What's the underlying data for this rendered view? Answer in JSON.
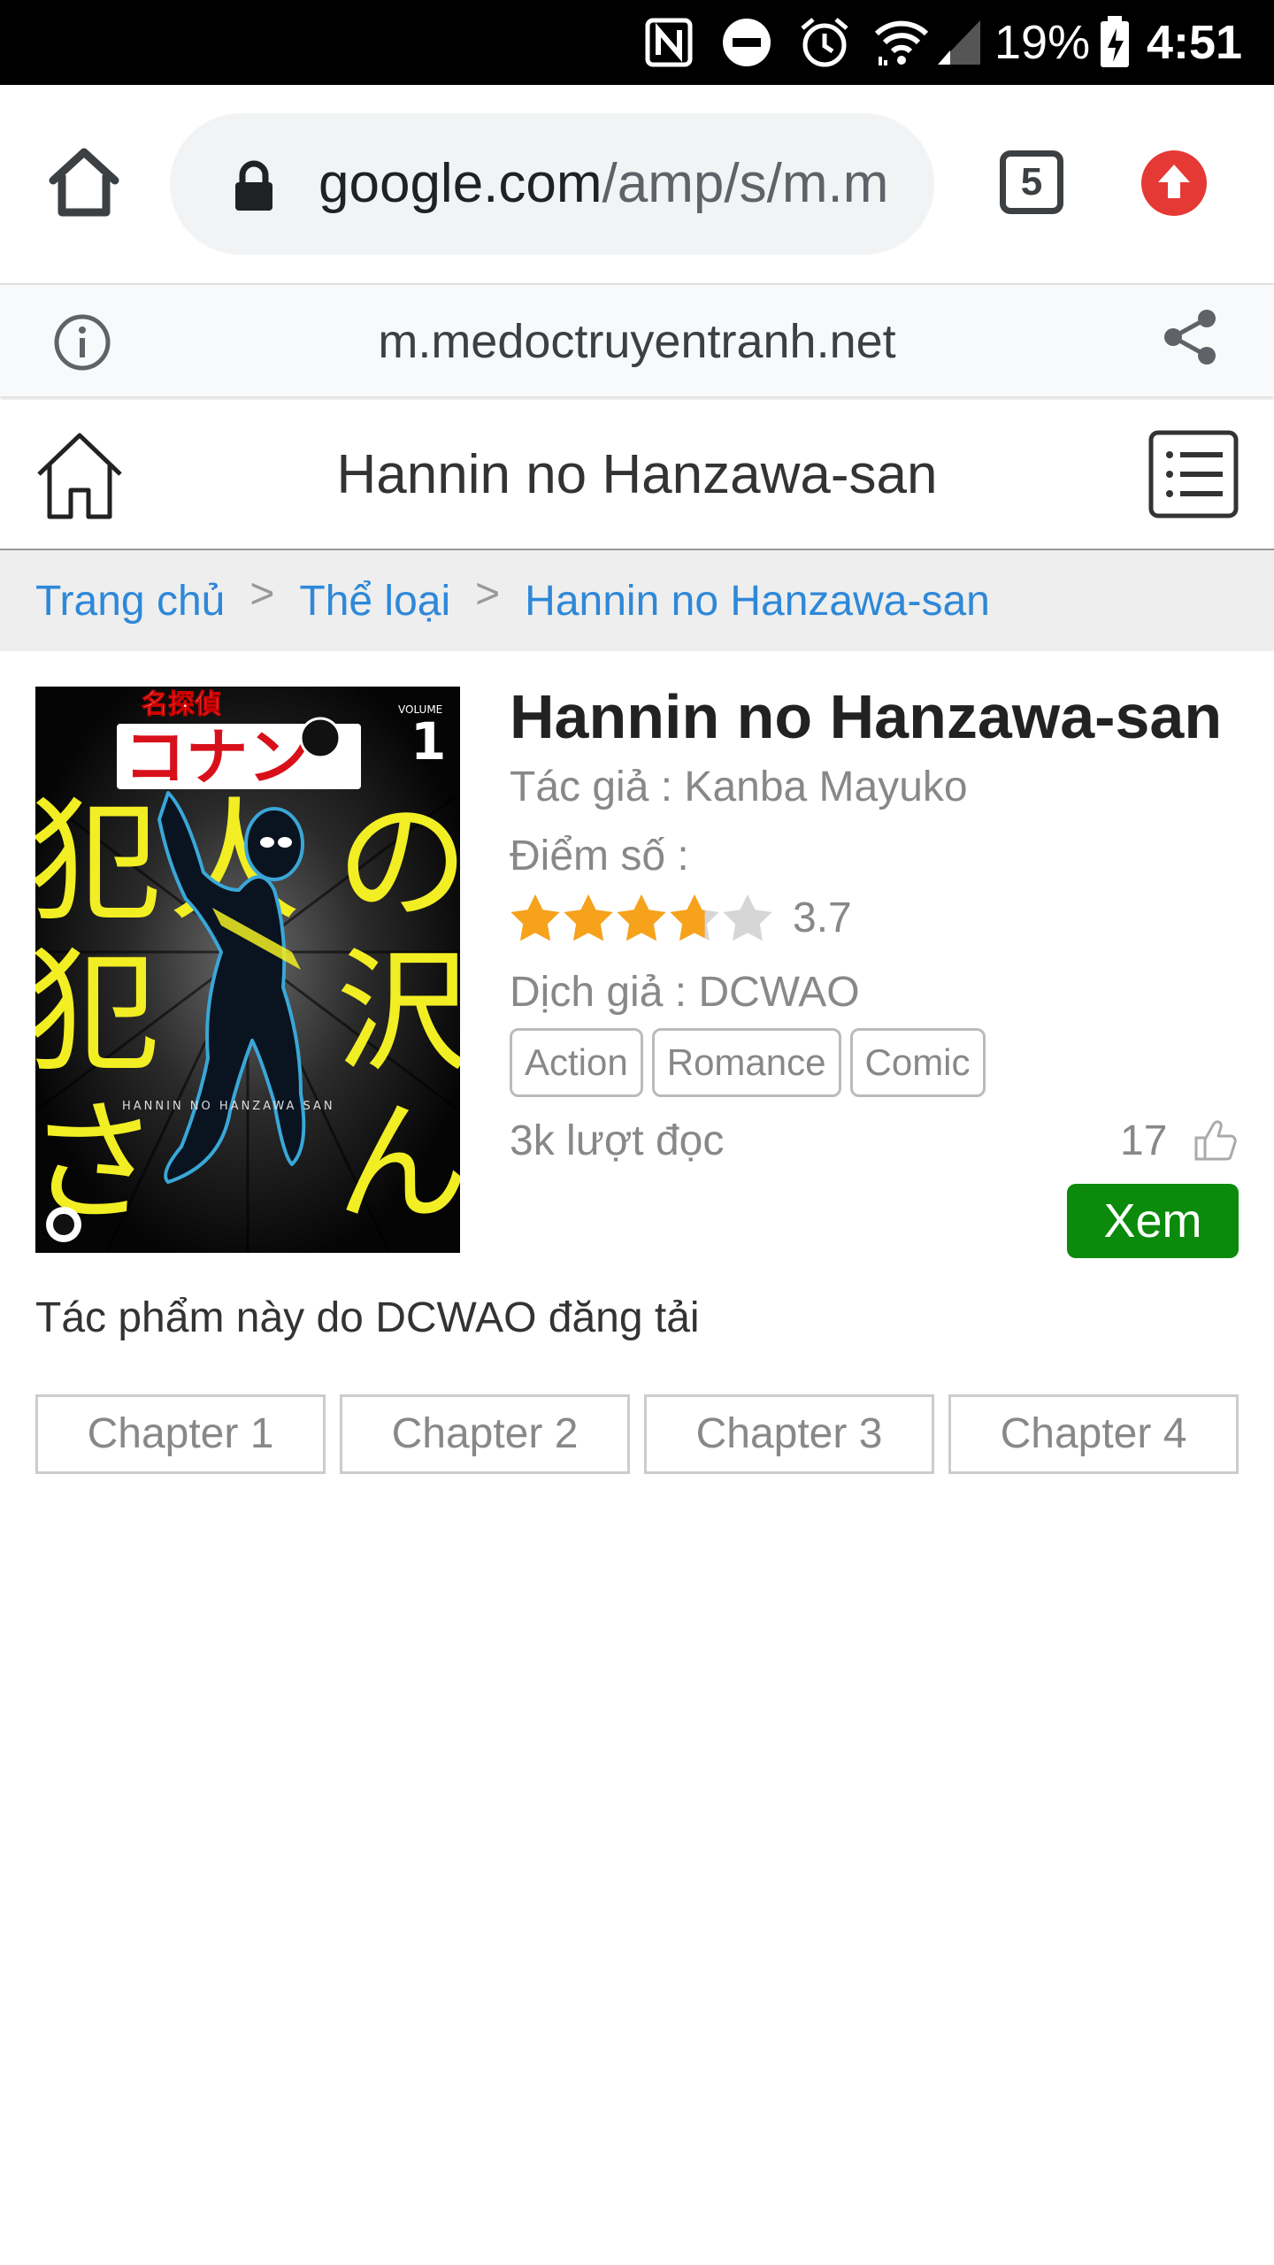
{
  "status_bar": {
    "battery": "19%",
    "time": "4:51",
    "icons": [
      "nfc-icon",
      "do-not-disturb-icon",
      "alarm-icon",
      "wifi-icon",
      "signal-icon",
      "battery-charging-icon"
    ]
  },
  "browser": {
    "url_main": "google.com",
    "url_rest": "/amp/s/m.m",
    "tab_count": "5",
    "amp_domain": "m.medoctruyentranh.net"
  },
  "site": {
    "header_title": "Hannin no Hanzawa-san",
    "breadcrumb": [
      "Trang chủ",
      "Thể loại",
      "Hannin no Hanzawa-san"
    ],
    "breadcrumb_sep": ">"
  },
  "manga": {
    "title": "Hannin no Hanzawa-san",
    "author_label": "Tác giả",
    "author": "Kanba Mayuko",
    "score_label": "Điểm số",
    "rating": 3.7,
    "rating_text": "3.7",
    "translator_label": "Dịch giả",
    "translator": "DCWAO",
    "tags": [
      "Action",
      "Romance",
      "Comic"
    ],
    "reads": "3k lượt đọc",
    "likes": "17",
    "view_button": "Xem",
    "uploader_text": "Tác phẩm này do DCWAO đăng tải",
    "cover_texts": {
      "brand_top": "名探偵",
      "brand_main": "コナン",
      "volume_label": "VOLUME",
      "volume_number": "1",
      "subtitle": "HANNIN NO HANZAWA SAN",
      "big_chars": [
        "犯",
        "人",
        "の",
        "犯",
        "沢",
        "さ",
        "ん"
      ]
    }
  },
  "chapters": [
    "Chapter 1",
    "Chapter 2",
    "Chapter 3",
    "Chapter 4"
  ],
  "colors": {
    "link": "#2e88d8",
    "view_button": "#0c8a0c",
    "star_filled": "#f7a21b",
    "star_empty": "#d6d6d6",
    "update_badge": "#e53935"
  }
}
